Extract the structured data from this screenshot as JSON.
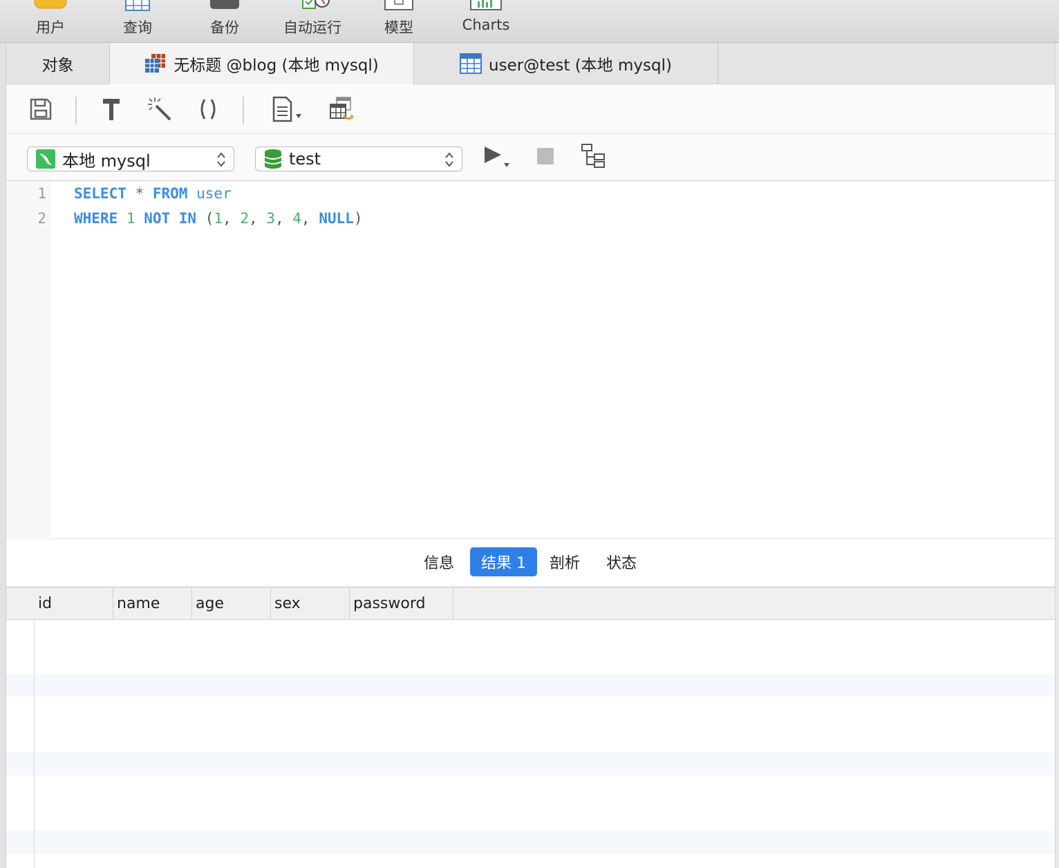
{
  "toolbar": {
    "items": [
      {
        "label": "用户",
        "icon": "user-icon"
      },
      {
        "label": "查询",
        "icon": "query-icon"
      },
      {
        "label": "备份",
        "icon": "backup-icon"
      },
      {
        "label": "自动运行",
        "icon": "automation-icon"
      },
      {
        "label": "模型",
        "icon": "model-icon"
      },
      {
        "label": "Charts",
        "icon": "charts-icon"
      }
    ]
  },
  "tabs": {
    "objects_label": "对象",
    "tab1_label": "无标题 @blog (本地 mysql)",
    "tab2_label": "user@test (本地 mysql)"
  },
  "connection": {
    "server": "本地 mysql",
    "database": "test"
  },
  "editor": {
    "lines": [
      "1",
      "2"
    ],
    "code": {
      "l1_kw1": "SELECT",
      "l1_op": "*",
      "l1_kw2": "FROM",
      "l1_table": "user",
      "l2_kw1": "WHERE",
      "l2_n0": "1",
      "l2_kw2": "NOT IN",
      "l2_open": "(",
      "l2_n1": "1",
      "l2_n2": "2",
      "l2_n3": "3",
      "l2_n4": "4",
      "l2_null": "NULL",
      "l2_close": ")",
      "comma": ","
    }
  },
  "result_tabs": [
    "信息",
    "结果 1",
    "剖析",
    "状态"
  ],
  "grid": {
    "columns": [
      "id",
      "name",
      "age",
      "sex",
      "password"
    ]
  },
  "colors": {
    "accent": "#2e7fe8",
    "keyword": "#3b8ee0",
    "number": "#4cae6c",
    "mysql_green": "#3dbd5c"
  }
}
